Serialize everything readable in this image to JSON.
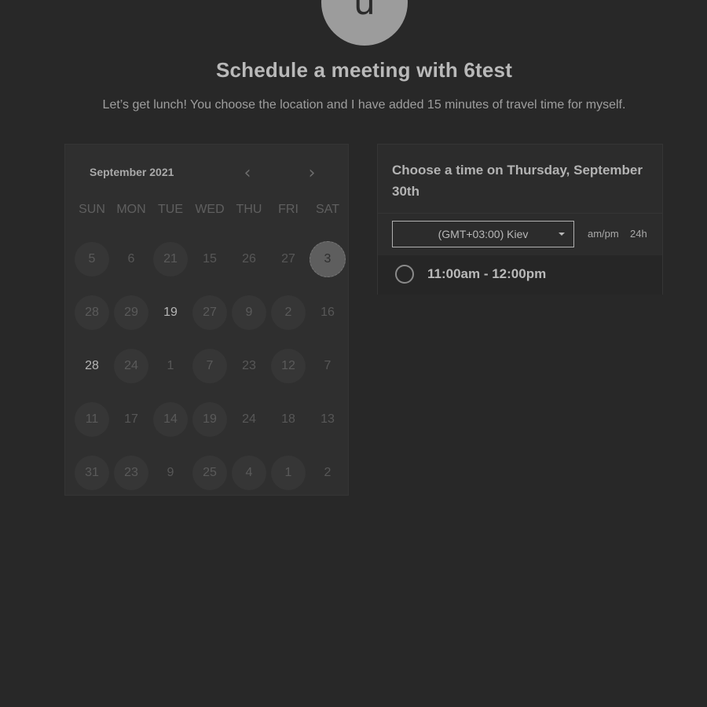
{
  "host": {
    "avatar_letter": "u"
  },
  "header": {
    "title": "Schedule a meeting with 6test",
    "subtitle": "Let’s get lunch! You choose the location and I have added 15 minutes of travel time for myself."
  },
  "calendar": {
    "month_label": "September 2021",
    "prev_icon": "chevron-left-icon",
    "next_icon": "chevron-right-icon",
    "weekdays": [
      "SUN",
      "MON",
      "TUE",
      "WED",
      "THU",
      "FRI",
      "SAT"
    ],
    "days": [
      {
        "label": "5",
        "state": "available"
      },
      {
        "label": "6",
        "state": "plain"
      },
      {
        "label": "21",
        "state": "available"
      },
      {
        "label": "15",
        "state": "plain"
      },
      {
        "label": "26",
        "state": "plain"
      },
      {
        "label": "27",
        "state": "plain"
      },
      {
        "label": "3",
        "state": "selected"
      },
      {
        "label": "28",
        "state": "available"
      },
      {
        "label": "29",
        "state": "available"
      },
      {
        "label": "19",
        "state": "bright"
      },
      {
        "label": "27",
        "state": "available"
      },
      {
        "label": "9",
        "state": "available"
      },
      {
        "label": "2",
        "state": "available"
      },
      {
        "label": "16",
        "state": "plain"
      },
      {
        "label": "28",
        "state": "bright"
      },
      {
        "label": "24",
        "state": "available"
      },
      {
        "label": "1",
        "state": "plain"
      },
      {
        "label": "7",
        "state": "available"
      },
      {
        "label": "23",
        "state": "plain"
      },
      {
        "label": "12",
        "state": "available"
      },
      {
        "label": "7",
        "state": "plain"
      },
      {
        "label": "11",
        "state": "available"
      },
      {
        "label": "17",
        "state": "plain"
      },
      {
        "label": "14",
        "state": "available"
      },
      {
        "label": "19",
        "state": "available"
      },
      {
        "label": "24",
        "state": "plain"
      },
      {
        "label": "18",
        "state": "plain"
      },
      {
        "label": "13",
        "state": "plain"
      },
      {
        "label": "31",
        "state": "available"
      },
      {
        "label": "23",
        "state": "available"
      },
      {
        "label": "9",
        "state": "plain"
      },
      {
        "label": "25",
        "state": "available"
      },
      {
        "label": "4",
        "state": "available"
      },
      {
        "label": "1",
        "state": "available"
      },
      {
        "label": "2",
        "state": "plain"
      }
    ]
  },
  "times": {
    "heading": "Choose a time on Thursday, September 30th",
    "timezone": "(GMT+03:00) Kiev",
    "format_ampm": "am/pm",
    "format_24h": "24h",
    "slots": [
      {
        "label": "11:00am - 12:00pm"
      }
    ]
  },
  "colors": {
    "background": "#282828",
    "selected_day": "#5e5e5e"
  }
}
